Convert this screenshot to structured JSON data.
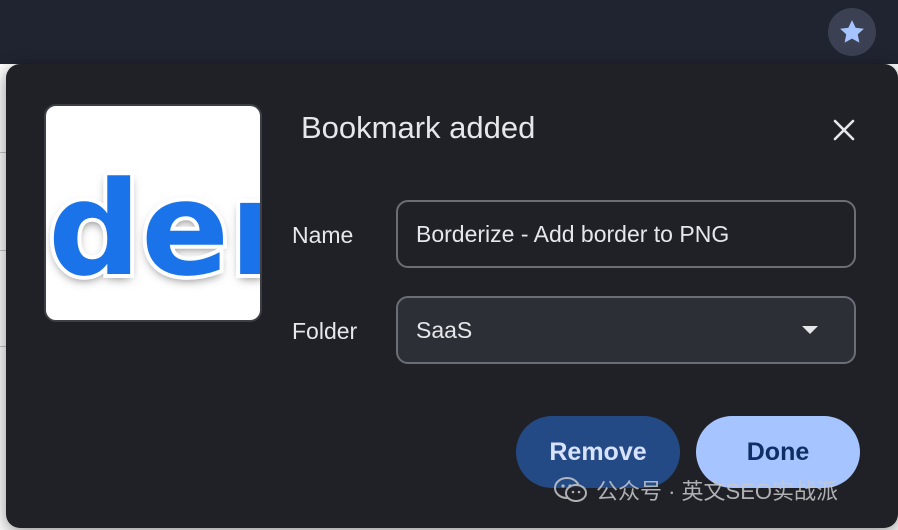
{
  "dialog": {
    "title": "Bookmark added",
    "name_label": "Name",
    "name_value": "Borderize - Add border to PNG",
    "folder_label": "Folder",
    "folder_value": "SaaS",
    "remove_label": "Remove",
    "done_label": "Done"
  },
  "thumbnail": {
    "text": "der",
    "text_color": "#1a73e8"
  },
  "watermark": {
    "text": "公众号 · 英文SEO实战派"
  },
  "icons": {
    "star": "star-icon",
    "close": "close-icon",
    "dropdown": "chevron-down-icon",
    "wechat": "wechat-icon"
  },
  "colors": {
    "dialog_bg": "#1f2127",
    "done_bg": "#a6c4ff",
    "remove_bg": "#244a86",
    "star_fill": "#a6c4ff"
  }
}
